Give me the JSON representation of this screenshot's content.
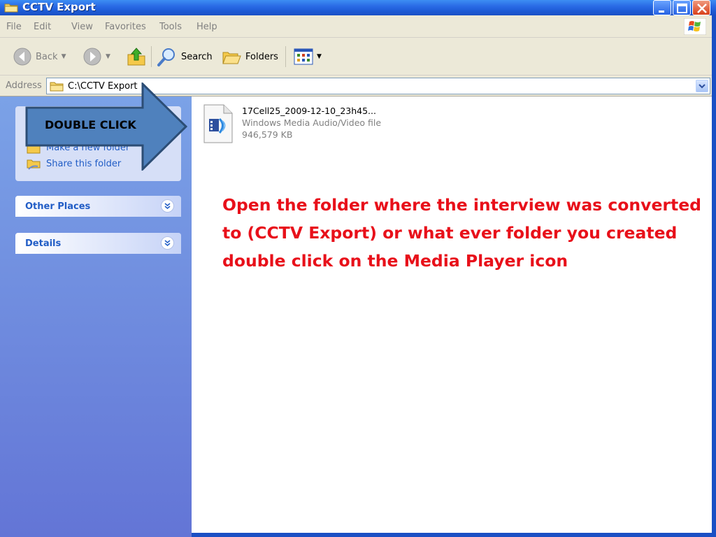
{
  "window": {
    "title": "CCTV Export"
  },
  "menu": {
    "items": [
      "File",
      "Edit",
      "View",
      "Favorites",
      "Tools",
      "Help"
    ]
  },
  "toolbar": {
    "back_label": "Back",
    "search_label": "Search",
    "folders_label": "Folders"
  },
  "address": {
    "label": "Address",
    "path": "C:\\CCTV Export"
  },
  "tasks": {
    "items": [
      {
        "label": "Make a new folder",
        "icon": "new-folder-icon"
      },
      {
        "label": "Share this folder",
        "icon": "share-folder-icon"
      }
    ]
  },
  "panels": {
    "other_places": "Other Places",
    "details": "Details"
  },
  "file": {
    "name": "17Cell25_2009-12-10_23h45...",
    "type": "Windows Media Audio/Video file",
    "size": "946,579 KB",
    "icon": "media-file-icon"
  },
  "callout": {
    "text": "DOUBLE CLICK"
  },
  "instruction": {
    "text": "Open the folder where the interview was converted to (CCTV Export) or what ever folder you created double click on the Media Player icon"
  },
  "colors": {
    "titlebar": "#2a6be6",
    "instruction": "#e8101a",
    "callout_fill": "#4f81bd",
    "link": "#215dc6"
  }
}
